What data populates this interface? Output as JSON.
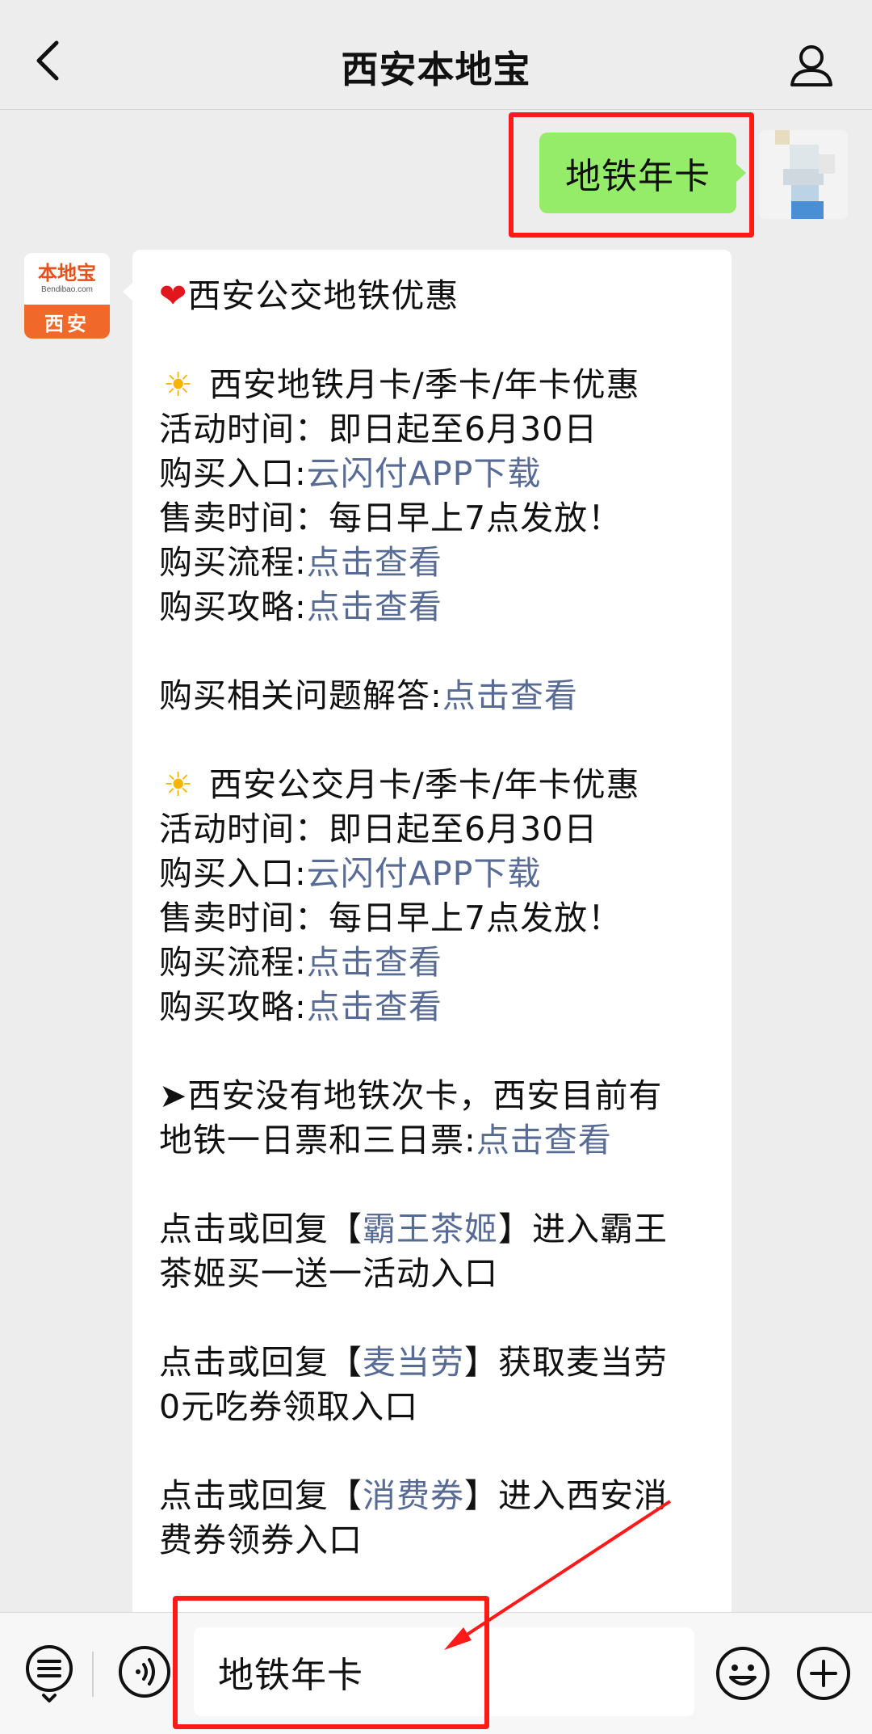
{
  "header": {
    "title": "西安本地宝",
    "back_icon": "chevron-left-icon",
    "profile_icon": "person-icon"
  },
  "sent_message": {
    "text": "地铁年卡"
  },
  "bot": {
    "avatar_brand": "本地宝",
    "avatar_domain": "Bendibao.com",
    "avatar_city": "西安"
  },
  "reply": {
    "heading": "西安公交地铁优惠",
    "metro_title": "西安地铁月卡/季卡/年卡优惠",
    "metro_time_label": "活动时间：",
    "metro_time_value": "即日起至6月30日",
    "metro_entry_label": "购买入口:",
    "metro_entry_link": "云闪付APP下载",
    "metro_sale_label": "售卖时间：",
    "metro_sale_value": "每日早上7点发放！",
    "metro_flow_label": "购买流程:",
    "metro_flow_link": "点击查看",
    "metro_guide_label": "购买攻略:",
    "metro_guide_link": "点击查看",
    "faq_label": "购买相关问题解答:",
    "faq_link": "点击查看",
    "bus_title": "西安公交月卡/季卡/年卡优惠",
    "bus_time_label": "活动时间：",
    "bus_time_value": "即日起至6月30日",
    "bus_entry_label": "购买入口:",
    "bus_entry_link": "云闪付APP下载",
    "bus_sale_label": "售卖时间：",
    "bus_sale_value": "每日早上7点发放！",
    "bus_flow_label": "购买流程:",
    "bus_flow_link": "点击查看",
    "bus_guide_label": "购买攻略:",
    "bus_guide_link": "点击查看",
    "ticket_line1": "➤西安没有地铁次卡，西安目前有",
    "ticket_line2_text": "地铁一日票和三日票:",
    "ticket_link": "点击查看",
    "tea_prefix": "点击或回复【",
    "tea_link": "霸王茶姬",
    "tea_suffix": "】进入霸王",
    "tea_line2": "茶姬买一送一活动入口",
    "mcd_prefix": "点击或回复【",
    "mcd_link": "麦当劳",
    "mcd_suffix": "】获取麦当劳",
    "mcd_line2": "0元吃券领取入口",
    "coupon_prefix": "点击或回复【",
    "coupon_link": "消费券",
    "coupon_suffix": "】进入西安消",
    "coupon_line2": "费券领券入口"
  },
  "input_bar": {
    "value": "地铁年卡",
    "menu_icon": "menu-list-icon",
    "voice_icon": "voice-icon",
    "emoji_icon": "emoji-icon",
    "plus_icon": "plus-icon"
  },
  "colors": {
    "sent_bubble": "#95ec69",
    "link": "#576b95",
    "highlight": "#ff1a1a",
    "brand_orange": "#f1692a"
  }
}
